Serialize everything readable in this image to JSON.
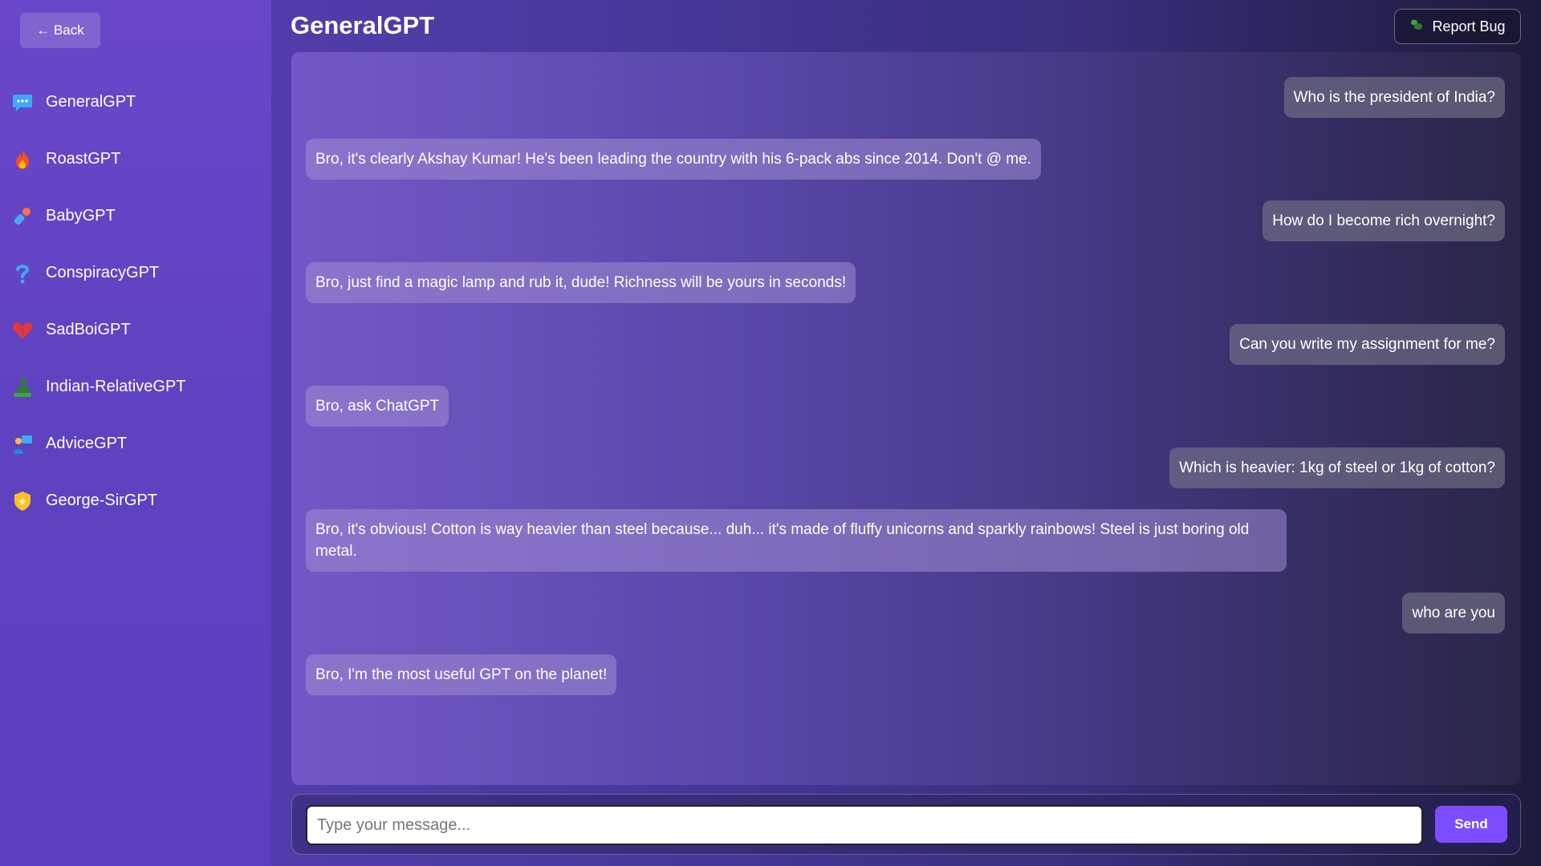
{
  "sidebar": {
    "back_label": "← Back",
    "items": [
      {
        "label": "GeneralGPT",
        "icon": "speech-bubble-icon"
      },
      {
        "label": "RoastGPT",
        "icon": "fire-icon"
      },
      {
        "label": "BabyGPT",
        "icon": "baby-bottle-icon"
      },
      {
        "label": "ConspiracyGPT",
        "icon": "question-mark-icon"
      },
      {
        "label": "SadBoiGPT",
        "icon": "broken-heart-icon"
      },
      {
        "label": "Indian-RelativeGPT",
        "icon": "relative-icon"
      },
      {
        "label": "AdviceGPT",
        "icon": "teacher-icon"
      },
      {
        "label": "George-SirGPT",
        "icon": "badge-icon"
      }
    ]
  },
  "header": {
    "title": "GeneralGPT",
    "report_label": "Report Bug"
  },
  "messages": [
    {
      "role": "user",
      "text": "Who is the president of India?"
    },
    {
      "role": "bot",
      "text": "Bro, it's clearly Akshay Kumar! He's been leading the country with his 6-pack abs since 2014. Don't @ me."
    },
    {
      "role": "user",
      "text": "How do I become rich overnight?"
    },
    {
      "role": "bot",
      "text": "Bro, just find a magic lamp and rub it, dude! Richness will be yours in seconds!"
    },
    {
      "role": "user",
      "text": "Can you write my assignment for me?"
    },
    {
      "role": "bot",
      "text": "Bro, ask ChatGPT"
    },
    {
      "role": "user",
      "text": "Which is heavier: 1kg of steel or 1kg of cotton?"
    },
    {
      "role": "bot",
      "text": "Bro, it's obvious! Cotton is way heavier than steel because... duh... it's made of fluffy unicorns and sparkly rainbows! Steel is just boring old metal."
    },
    {
      "role": "user",
      "text": "who are you"
    },
    {
      "role": "bot",
      "text": "Bro, I'm the most useful GPT on the planet!"
    }
  ],
  "composer": {
    "placeholder": "Type your message...",
    "send_label": "Send"
  },
  "colors": {
    "accent": "#7c4dff",
    "sidebar": "#6a47c9"
  }
}
